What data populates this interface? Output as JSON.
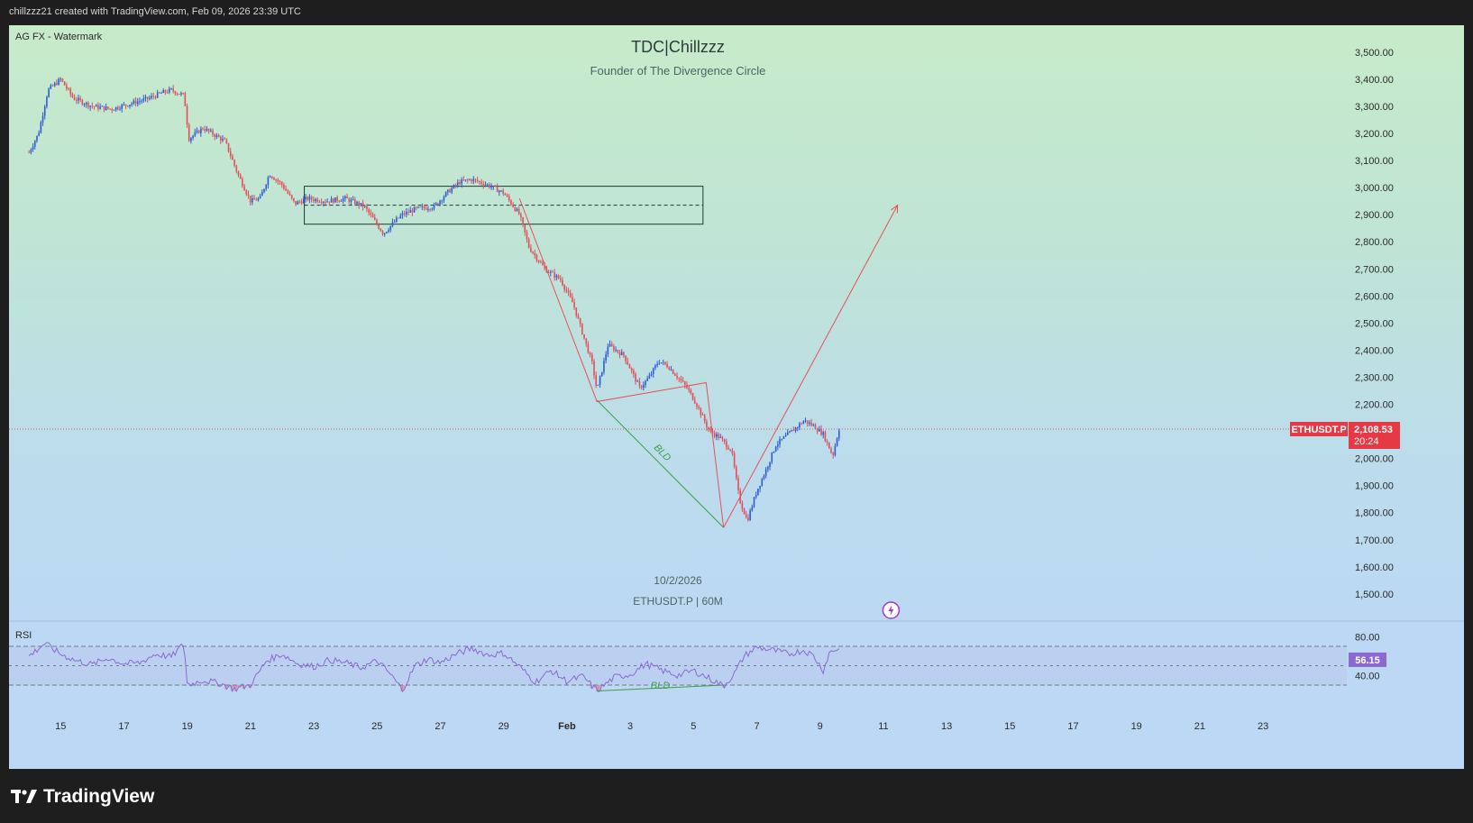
{
  "header": {
    "credit": "chillzzz21 created with TradingView.com, Feb 09, 2026 23:39 UTC"
  },
  "watermark": "AG FX - Watermark",
  "title": "TDC|Chillzzz",
  "subtitle": "Founder of The Divergence Circle",
  "info_date": "10/2/2026",
  "info_symbol": "ETHUSDT.P | 60M",
  "symbol_tag": "ETHUSDT.P",
  "price_tag": "2,108.53",
  "countdown_tag": "20:24",
  "rsi_label": "RSI",
  "rsi_value_tag": "56.15",
  "bld_label": "BLD",
  "brand": "TradingView",
  "colors": {
    "up_candle": "#2f5bd6",
    "down_candle": "#e0505a",
    "drawing_red": "#e8505a",
    "divergence_green": "#3f9e4a",
    "rsi_line": "#8a6ad0",
    "price_tag_bg": "#e53945"
  },
  "chart_data": [
    {
      "type": "candlestick",
      "symbol": "ETHUSDT.P",
      "timeframe": "60M",
      "x_tick_labels": [
        "15",
        "17",
        "19",
        "21",
        "23",
        "25",
        "27",
        "29",
        "Feb",
        "3",
        "5",
        "7",
        "9",
        "11",
        "13",
        "15",
        "17",
        "19",
        "21",
        "23"
      ],
      "y_tick_labels": [
        "3,500.00",
        "3,400.00",
        "3,300.00",
        "3,200.00",
        "3,100.00",
        "3,000.00",
        "2,900.00",
        "2,800.00",
        "2,700.00",
        "2,600.00",
        "2,500.00",
        "2,400.00",
        "2,300.00",
        "2,200.00",
        "2,100.00",
        "2,000.00",
        "1,900.00",
        "1,800.00",
        "1,700.00",
        "1,600.00",
        "1,500.00"
      ],
      "ylim": [
        1460,
        3570
      ],
      "last_price": 2108.53,
      "price_path_days": [
        14.0,
        14.3,
        14.6,
        15.0,
        15.4,
        16.0,
        16.6,
        17.2,
        17.8,
        18.2,
        18.5,
        18.9,
        19.05,
        19.5,
        20.2,
        20.6,
        21.0,
        21.3,
        21.6,
        22.0,
        22.4,
        22.8,
        23.4,
        24.0,
        24.6,
        25.2,
        25.6,
        25.8,
        26.2,
        26.8,
        27.2,
        27.6,
        28.0,
        28.5,
        29.0,
        29.5,
        29.8,
        30.3,
        30.8,
        31.2,
        31.5,
        31.8,
        31.95,
        32.3,
        32.8,
        33.3,
        33.6,
        33.9,
        34.2,
        34.5,
        34.8,
        35.1,
        35.5,
        35.8,
        36.2,
        36.45,
        36.7,
        37.0,
        37.3,
        37.6,
        37.9,
        38.2,
        38.5,
        38.8,
        39.1,
        39.4,
        39.6
      ],
      "price_path_values": [
        3130,
        3200,
        3360,
        3400,
        3330,
        3300,
        3290,
        3310,
        3330,
        3350,
        3360,
        3340,
        3180,
        3220,
        3170,
        3050,
        2950,
        2960,
        3050,
        3010,
        2940,
        2960,
        2950,
        2960,
        2930,
        2830,
        2880,
        2900,
        2920,
        2930,
        2980,
        3020,
        3030,
        3010,
        2980,
        2900,
        2780,
        2700,
        2660,
        2570,
        2460,
        2350,
        2250,
        2420,
        2380,
        2260,
        2300,
        2360,
        2340,
        2300,
        2260,
        2200,
        2100,
        2080,
        2030,
        1850,
        1770,
        1880,
        1960,
        2050,
        2080,
        2110,
        2140,
        2120,
        2090,
        2010,
        2110
      ],
      "zone": {
        "x": [
          22.7,
          35.3
        ],
        "y": [
          2865,
          3005
        ],
        "midline": 2935
      },
      "projection": {
        "from": [
          35.95,
          1745
        ],
        "to": [
          41.45,
          2935
        ]
      },
      "zigzag": [
        [
          29.5,
          2960
        ],
        [
          31.95,
          2210
        ],
        [
          35.4,
          2280
        ],
        [
          35.95,
          1745
        ]
      ],
      "bld_price": {
        "from": [
          31.95,
          2215
        ],
        "to": [
          35.95,
          1745
        ]
      }
    },
    {
      "type": "line",
      "name": "RSI",
      "y_tick_labels": [
        "80.00",
        "40.00"
      ],
      "levels": [
        70,
        50,
        30
      ],
      "ylim": [
        20,
        90
      ],
      "last_value": 56.15,
      "rsi_path_days": [
        14.0,
        14.5,
        15.0,
        15.5,
        16.0,
        16.5,
        17.0,
        17.5,
        18.0,
        18.5,
        18.9,
        19.0,
        19.5,
        20.0,
        20.5,
        21.0,
        21.5,
        22.0,
        22.5,
        23.0,
        23.5,
        24.0,
        24.5,
        25.0,
        25.4,
        25.8,
        26.2,
        26.6,
        27.0,
        27.5,
        28.0,
        28.5,
        29.0,
        29.5,
        30.0,
        30.5,
        31.0,
        31.5,
        31.95,
        32.5,
        33.0,
        33.5,
        34.0,
        34.5,
        35.0,
        35.5,
        35.95,
        36.3,
        36.6,
        37.0,
        37.5,
        38.0,
        38.5,
        38.8,
        39.1,
        39.3,
        39.6
      ],
      "rsi_path_values": [
        60,
        73,
        62,
        55,
        51,
        58,
        52,
        53,
        62,
        59,
        73,
        30,
        35,
        32,
        26,
        30,
        55,
        62,
        52,
        49,
        56,
        53,
        48,
        55,
        42,
        25,
        50,
        57,
        53,
        62,
        68,
        61,
        63,
        49,
        33,
        45,
        34,
        39,
        24,
        38,
        41,
        52,
        45,
        40,
        45,
        37,
        29,
        42,
        60,
        69,
        66,
        62,
        66,
        60,
        45,
        64,
        68
      ],
      "bld_rsi": {
        "from": [
          31.95,
          24
        ],
        "to": [
          35.95,
          30
        ]
      }
    }
  ]
}
